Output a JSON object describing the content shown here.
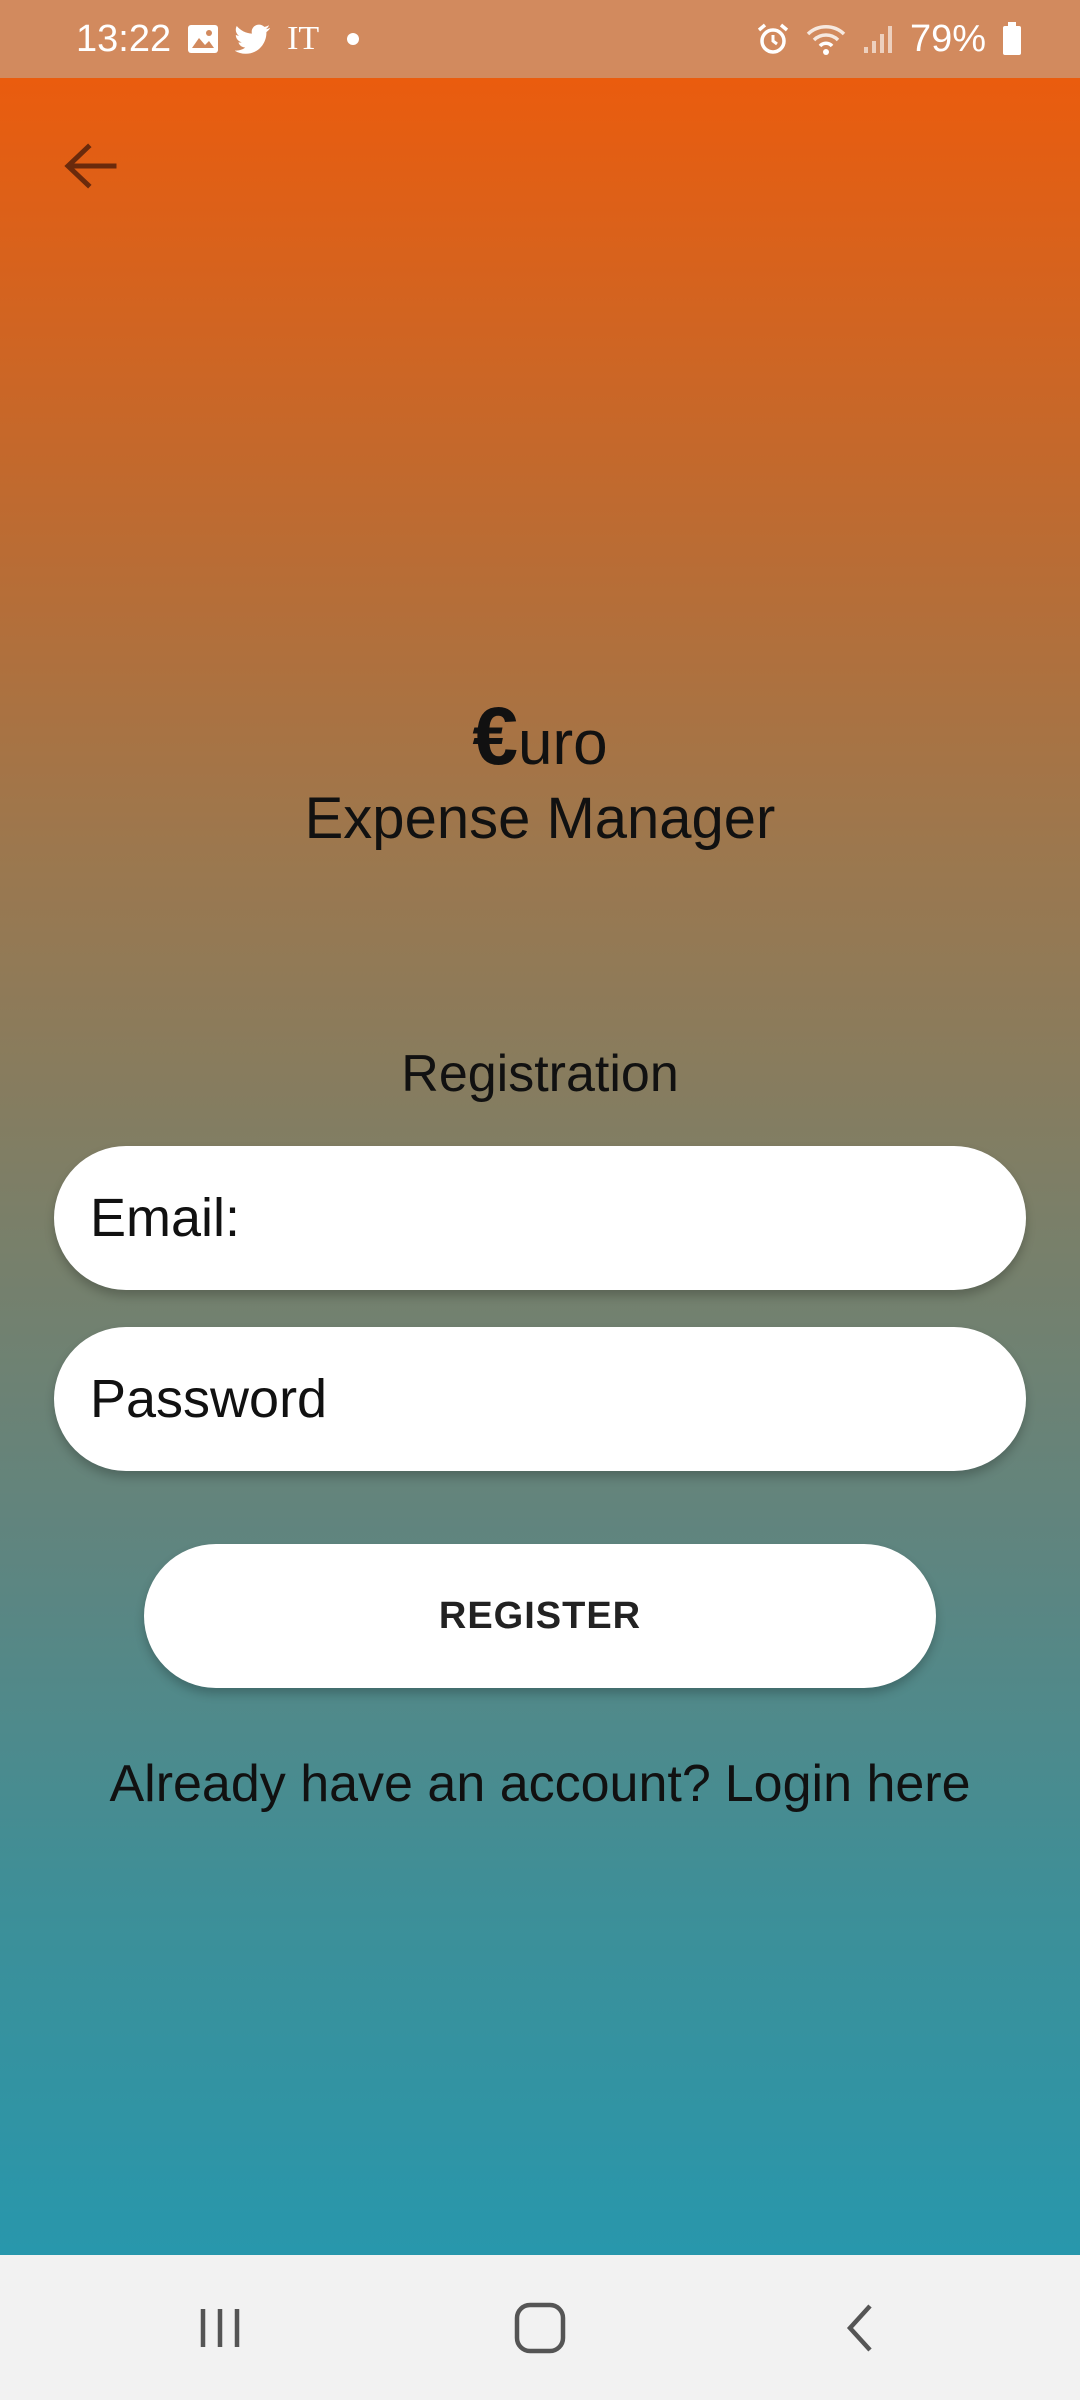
{
  "status_bar": {
    "time": "13:22",
    "carrier_text": "IT",
    "battery": "79%",
    "icons": [
      "image-icon",
      "twitter-icon",
      "notification-dot",
      "alarm-icon",
      "wifi-icon",
      "signal-icon",
      "battery-icon"
    ]
  },
  "header": {
    "back_icon": "arrow-left-icon"
  },
  "branding": {
    "euro_symbol": "€",
    "title_suffix": "uro",
    "subtitle": "Expense Manager"
  },
  "form": {
    "heading": "Registration",
    "email_placeholder": "Email:",
    "password_placeholder": "Password",
    "submit_label": "REGISTER"
  },
  "footer": {
    "prompt": "Already have an account?",
    "link_label": "Login here"
  },
  "nav_bar": {
    "icons": [
      "recent-apps-icon",
      "home-icon",
      "back-icon"
    ]
  },
  "colors": {
    "gradient_top": "#ea5c0e",
    "gradient_bottom": "#2897ac",
    "status_bar": "#d28a5e",
    "nav_bar": "#f2f2f2"
  }
}
